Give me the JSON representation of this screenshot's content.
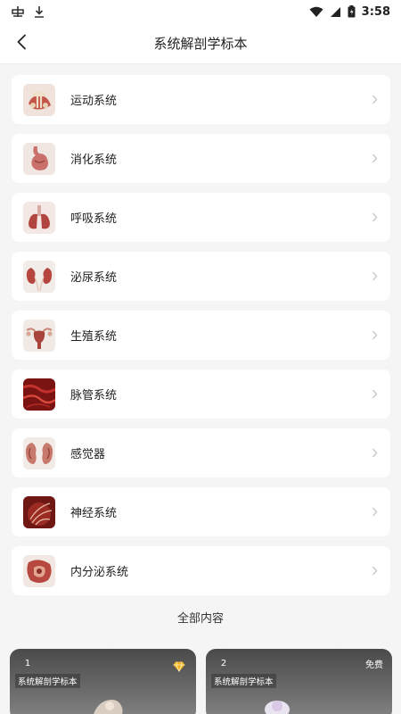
{
  "status_bar": {
    "time": "3:58",
    "icons": [
      "app-notification-icon",
      "download-icon",
      "wifi-icon",
      "signal-icon",
      "battery-icon"
    ]
  },
  "header": {
    "title": "系统解剖学标本",
    "back_icon": "chevron-left-icon"
  },
  "systems": [
    {
      "label": "运动系统",
      "icon": "skeleton-thumbnail"
    },
    {
      "label": "消化系统",
      "icon": "stomach-thumbnail"
    },
    {
      "label": "呼吸系统",
      "icon": "lungs-thumbnail"
    },
    {
      "label": "泌尿系统",
      "icon": "kidneys-thumbnail"
    },
    {
      "label": "生殖系统",
      "icon": "uterus-thumbnail"
    },
    {
      "label": "脉管系统",
      "icon": "vessels-thumbnail"
    },
    {
      "label": "感觉器",
      "icon": "ear-thumbnail"
    },
    {
      "label": "神经系统",
      "icon": "nerves-thumbnail"
    },
    {
      "label": "内分泌系统",
      "icon": "glands-thumbnail"
    }
  ],
  "all_content": {
    "title": "全部内容",
    "tiles": [
      {
        "number": "1",
        "caption": "系统解剖学标本",
        "badge_icon": "diamond-icon"
      },
      {
        "number": "2",
        "caption": "系统解剖学标本",
        "badge": "免费"
      }
    ]
  },
  "colors": {
    "background": "#f5f5f5",
    "card": "#ffffff",
    "tissue_red": "#a8322e",
    "premium_gold": "#f3b21f"
  }
}
